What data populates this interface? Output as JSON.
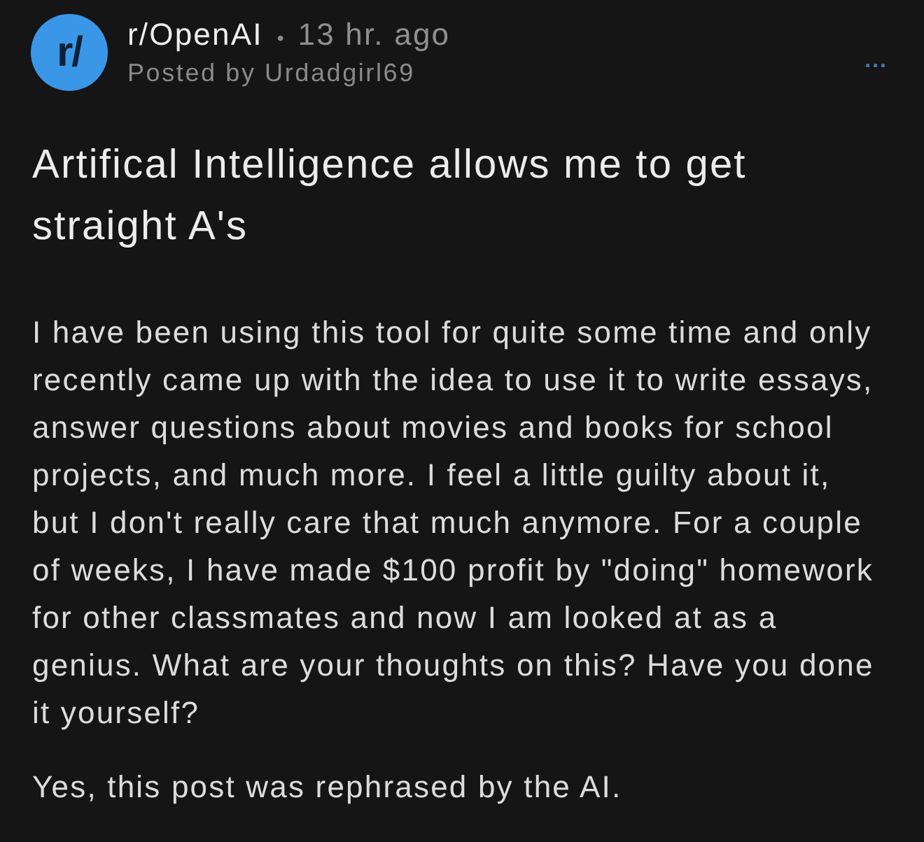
{
  "post": {
    "community_icon": "r/",
    "community": "r/OpenAI",
    "separator": "•",
    "time": "13 hr. ago",
    "author_line": "Posted by Urdadgirl69",
    "more_menu": "...",
    "title": "Artifical Intelligence allows me to get straight A's",
    "body": [
      "I have been using this tool for quite some time and only recently came up with the idea to use it to write essays, answer questions about movies and books for school projects, and much more. I feel a little guilty about it, but I don't really care that much anymore. For a couple of weeks, I have made $100 profit by \"doing\" homework for other classmates and now I am looked at as a genius. What are your thoughts on this? Have you done it yourself?",
      "Yes, this post was rephrased by the AI."
    ]
  }
}
